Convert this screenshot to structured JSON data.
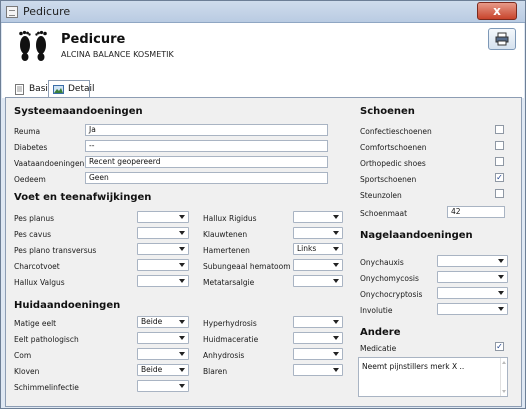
{
  "window": {
    "title": "Pedicure",
    "close_label": "x"
  },
  "header": {
    "title": "Pedicure",
    "subtitle": "ALCINA BALANCE KOSMETIK"
  },
  "tabs": [
    {
      "label": "Basis"
    },
    {
      "label": "Detail"
    }
  ],
  "systeem": {
    "title": "Systeemaandoeningen",
    "fields": [
      {
        "label": "Reuma",
        "value": "Ja"
      },
      {
        "label": "Diabetes",
        "value": "--"
      },
      {
        "label": "Vaataandoeningen",
        "value": "Recent geopereerd"
      },
      {
        "label": "Oedeem",
        "value": "Geen"
      }
    ]
  },
  "voet": {
    "title": "Voet en teenafwijkingen",
    "left": [
      {
        "label": "Pes planus",
        "value": ""
      },
      {
        "label": "Pes cavus",
        "value": ""
      },
      {
        "label": "Pes plano transversus",
        "value": ""
      },
      {
        "label": "Charcotvoet",
        "value": ""
      },
      {
        "label": "Hallux Valgus",
        "value": ""
      }
    ],
    "right": [
      {
        "label": "Hallux Rigidus",
        "value": ""
      },
      {
        "label": "Klauwtenen",
        "value": ""
      },
      {
        "label": "Hamertenen",
        "value": "Links"
      },
      {
        "label": "Subungeaal hematoom",
        "value": ""
      },
      {
        "label": "Metatarsalgie",
        "value": ""
      }
    ]
  },
  "huid": {
    "title": "Huidaandoeningen",
    "left": [
      {
        "label": "Matige eelt",
        "value": "Beide"
      },
      {
        "label": "Eelt pathologisch",
        "value": ""
      },
      {
        "label": "Com",
        "value": ""
      },
      {
        "label": "Kloven",
        "value": "Beide"
      },
      {
        "label": "Schimmelinfectie",
        "value": ""
      }
    ],
    "right": [
      {
        "label": "Hyperhydrosis",
        "value": ""
      },
      {
        "label": "Huidmaceratie",
        "value": ""
      },
      {
        "label": "Anhydrosis",
        "value": ""
      },
      {
        "label": "Blaren",
        "value": ""
      }
    ]
  },
  "schoenen": {
    "title": "Schoenen",
    "checks": [
      {
        "label": "Confectieschoenen",
        "checked": false
      },
      {
        "label": "Comfortschoenen",
        "checked": false
      },
      {
        "label": "Orthopedic shoes",
        "checked": false
      },
      {
        "label": "Sportschoenen",
        "checked": true
      },
      {
        "label": "Steunzolen",
        "checked": false
      }
    ],
    "maat_label": "Schoenmaat",
    "maat_value": "42"
  },
  "nagel": {
    "title": "Nagelaandoeningen",
    "fields": [
      {
        "label": "Onychauxis",
        "value": ""
      },
      {
        "label": "Onychomycosis",
        "value": ""
      },
      {
        "label": "Onychocryptosis",
        "value": ""
      },
      {
        "label": "Involutie",
        "value": ""
      }
    ]
  },
  "andere": {
    "title": "Andere",
    "medicatie_label": "Medicatie",
    "medicatie_checked": true,
    "notes": "Neemt pijnstillers merk X .."
  },
  "icons": {
    "check_glyph": "✓"
  }
}
